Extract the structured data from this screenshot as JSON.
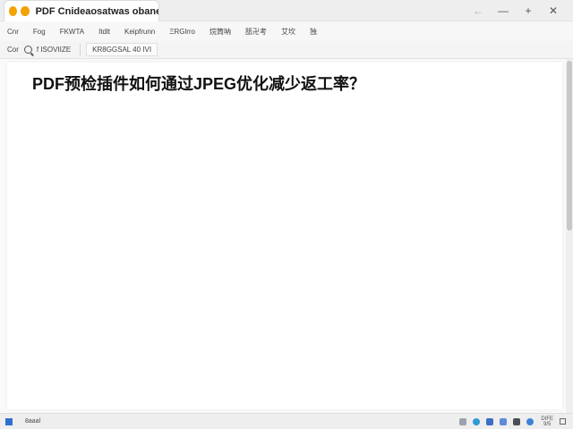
{
  "titlebar": {
    "tab_title": "PDF Cnideaosatwas obanecem",
    "back_glyph": "←",
    "minimize_glyph": "—",
    "add_glyph": "+",
    "close_glyph": "✕",
    "accent_color": "#f2a300"
  },
  "menubar": {
    "items": [
      "Cnr",
      "Fog",
      "FKWTA",
      "Itdlt",
      "Keipfrunn",
      "ΞRGlrro",
      "烷筒呐",
      "舐卍考",
      "艾坎",
      "独"
    ]
  },
  "toolbar": {
    "left_text": "Cor",
    "search_text": "f  ISOVIIZE",
    "field_text": "KR8GGSAL 40  IVI"
  },
  "document": {
    "title": "PDF预检插件如何通过JPEG优化减少返工率？"
  },
  "statusbar": {
    "left_text": "8aaal",
    "time_line1": "DIFE",
    "time_line2": "9/5"
  }
}
